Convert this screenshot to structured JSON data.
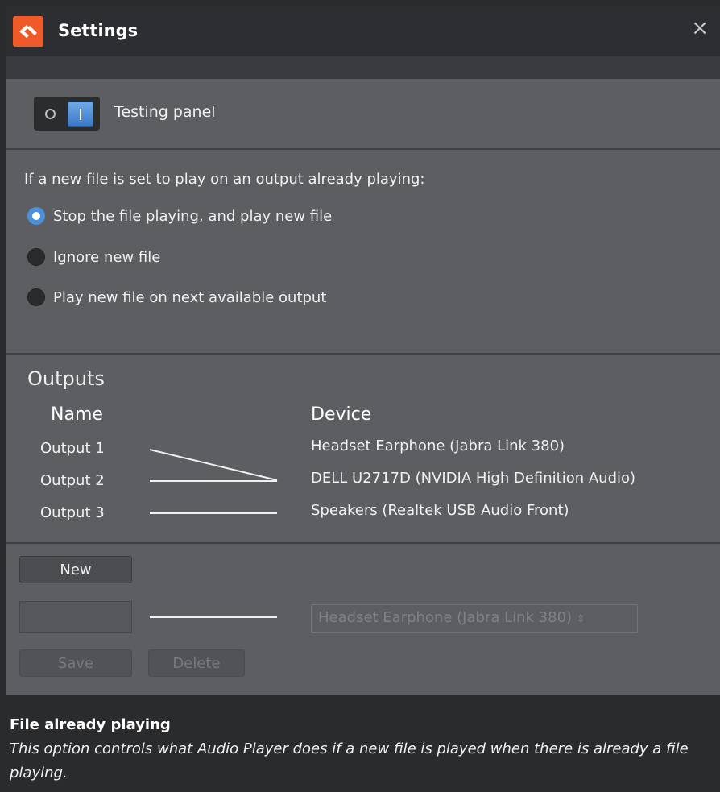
{
  "window": {
    "title": "Settings",
    "close_glyph": "×",
    "app_icon": "audio-player-logo-icon",
    "accent_color": "#f05a28"
  },
  "testing_panel": {
    "label": "Testing panel",
    "toggle_state": "on"
  },
  "playback": {
    "question": "If a new file is set to play on an output already playing:",
    "options": [
      {
        "label": "Stop the file playing, and play new file",
        "selected": true
      },
      {
        "label": "Ignore new file",
        "selected": false
      },
      {
        "label": "Play new file on next available output",
        "selected": false
      }
    ]
  },
  "outputs": {
    "title": "Outputs",
    "name_header": "Name",
    "device_header": "Device",
    "names": [
      "Output 1",
      "Output 2",
      "Output 3"
    ],
    "devices": [
      "Headset Earphone (Jabra Link 380)",
      "DELL U2717D (NVIDIA High Definition Audio)",
      "Speakers (Realtek USB Audio Front)"
    ],
    "mapping": [
      {
        "output": "Output 1",
        "device": "DELL U2717D (NVIDIA High Definition Audio)"
      },
      {
        "output": "Output 2",
        "device": "DELL U2717D (NVIDIA High Definition Audio)"
      },
      {
        "output": "Output 3",
        "device": "Speakers (Realtek USB Audio Front)"
      }
    ]
  },
  "editor": {
    "new_label": "New",
    "name_value": "",
    "device_selected": "Headset Earphone (Jabra Link 380)",
    "save_label": "Save",
    "delete_label": "Delete"
  },
  "help": {
    "title": "File already playing",
    "text": "This option controls what Audio Player does if a new file is played when there is already a file playing."
  }
}
